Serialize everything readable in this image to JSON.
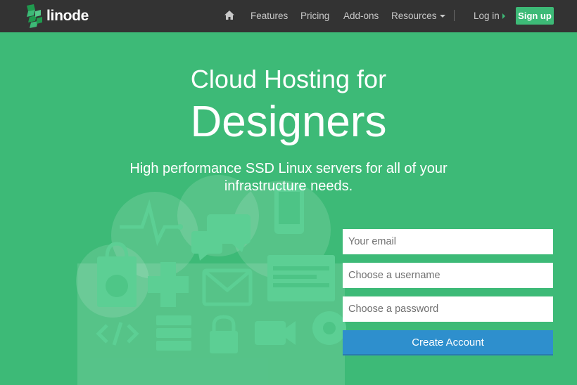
{
  "header": {
    "logo_text": "linode",
    "nav": [
      {
        "label": "Features"
      },
      {
        "label": "Pricing"
      },
      {
        "label": "Add-ons"
      },
      {
        "label": "Resources"
      }
    ],
    "login_label": "Log in",
    "signup_label": "Sign up"
  },
  "hero": {
    "title_line1": "Cloud Hosting for",
    "title_line2": "Designers",
    "tagline": "High performance SSD Linux servers for all of your infrastructure needs."
  },
  "form": {
    "email_placeholder": "Your email",
    "username_placeholder": "Choose a username",
    "password_placeholder": "Choose a password",
    "submit_label": "Create Account"
  },
  "colors": {
    "background": "#3dba77",
    "header": "#333333",
    "button": "#2e8fcd"
  },
  "icons": [
    "home-icon",
    "linode-logo-icon",
    "pulse-icon",
    "chat-icon",
    "tablet-icon",
    "shopping-bag-icon",
    "globe-icon",
    "dpad-icon",
    "envelope-icon",
    "browser-window-icon",
    "code-icon",
    "server-stack-icon",
    "lock-icon",
    "video-camera-icon",
    "gear-icon"
  ]
}
